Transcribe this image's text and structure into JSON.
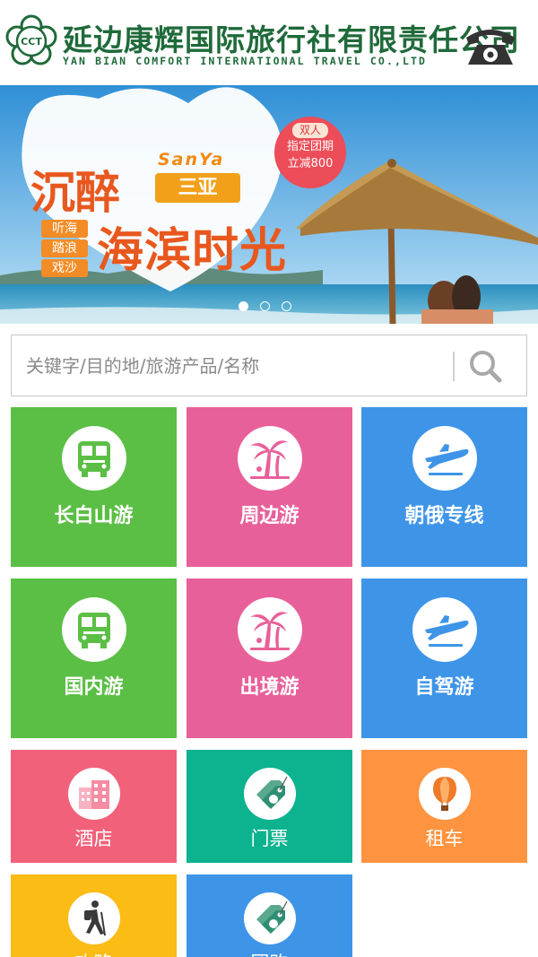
{
  "header": {
    "logo_abbr": "CCT",
    "company_cn": "延边康辉国际旅行社有限责任公司",
    "company_en": "YAN BIAN COMFORT INTERNATIONAL TRAVEL CO.,LTD"
  },
  "banner": {
    "headline_1": "沉醉",
    "sanya_en": "SanYa",
    "sanya_cn": "三亚",
    "headline_2": "海滨时光",
    "tags": [
      "听海",
      "踏浪",
      "戏沙"
    ],
    "promo": {
      "line1": "双人",
      "line2": "指定团期",
      "line3": "立减800"
    },
    "slide_count": 3,
    "active_slide": 0
  },
  "search": {
    "placeholder": "关键字/目的地/旅游产品/名称"
  },
  "categories": [
    {
      "label": "长白山游",
      "icon": "bus-icon",
      "color": "#5bbf45"
    },
    {
      "label": "周边游",
      "icon": "palm-tree-icon",
      "color": "#e8609a"
    },
    {
      "label": "朝俄专线",
      "icon": "airplane-icon",
      "color": "#3e95e8"
    },
    {
      "label": "国内游",
      "icon": "bus-icon",
      "color": "#5bbf45"
    },
    {
      "label": "出境游",
      "icon": "palm-tree-icon",
      "color": "#e8609a"
    },
    {
      "label": "自驾游",
      "icon": "airplane-icon",
      "color": "#3e95e8"
    },
    {
      "label": "酒店",
      "icon": "hotel-icon",
      "color": "#f2617a"
    },
    {
      "label": "门票",
      "icon": "ticket-tag-icon",
      "color": "#0db28f"
    },
    {
      "label": "租车",
      "icon": "hot-air-balloon-icon",
      "color": "#ff9440"
    },
    {
      "label": "攻略",
      "icon": "hiker-icon",
      "color": "#fcbc16"
    },
    {
      "label": "团购",
      "icon": "ticket-tag-icon",
      "color": "#3e95e8"
    }
  ]
}
